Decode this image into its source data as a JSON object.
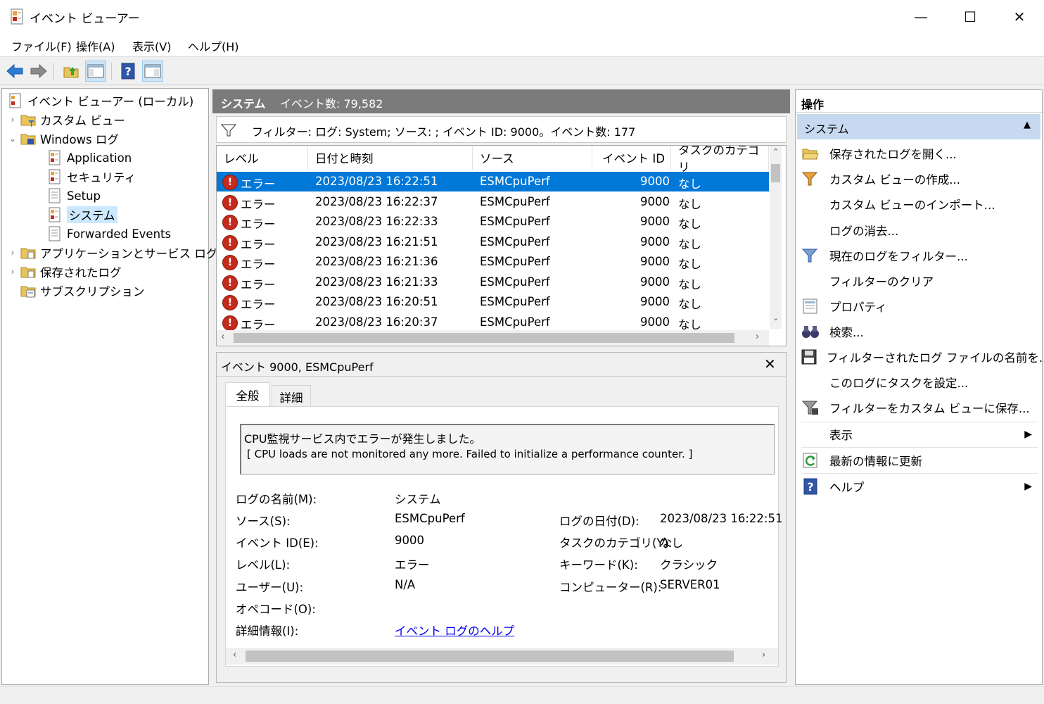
{
  "window": {
    "title": "イベント ビューアー",
    "minimize": "—",
    "maximize": "☐",
    "close": "✕"
  },
  "menu": [
    "ファイル(F)",
    "操作(A)",
    "表示(V)",
    "ヘルプ(H)"
  ],
  "tree": {
    "root": "イベント ビューアー (ローカル)",
    "custom_views": "カスタム ビュー",
    "windows_logs": "Windows ログ",
    "application": "Application",
    "security": "セキュリティ",
    "setup": "Setup",
    "system": "システム",
    "forwarded": "Forwarded Events",
    "app_service_logs": "アプリケーションとサービス ログ",
    "saved_logs": "保存されたログ",
    "subscriptions": "サブスクリプション"
  },
  "center": {
    "log_name": "システム",
    "event_count": "イベント数: 79,582",
    "filter_text": "フィルター: ログ: System; ソース: ; イベント ID: 9000。イベント数: 177"
  },
  "grid": {
    "columns": [
      "レベル",
      "日付と時刻",
      "ソース",
      "イベント ID",
      "タスクのカテゴリ"
    ],
    "rows": [
      {
        "level": "エラー",
        "datetime": "2023/08/23 16:22:51",
        "source": "ESMCpuPerf",
        "id": "9000",
        "category": "なし"
      },
      {
        "level": "エラー",
        "datetime": "2023/08/23 16:22:37",
        "source": "ESMCpuPerf",
        "id": "9000",
        "category": "なし"
      },
      {
        "level": "エラー",
        "datetime": "2023/08/23 16:22:33",
        "source": "ESMCpuPerf",
        "id": "9000",
        "category": "なし"
      },
      {
        "level": "エラー",
        "datetime": "2023/08/23 16:21:51",
        "source": "ESMCpuPerf",
        "id": "9000",
        "category": "なし"
      },
      {
        "level": "エラー",
        "datetime": "2023/08/23 16:21:36",
        "source": "ESMCpuPerf",
        "id": "9000",
        "category": "なし"
      },
      {
        "level": "エラー",
        "datetime": "2023/08/23 16:21:33",
        "source": "ESMCpuPerf",
        "id": "9000",
        "category": "なし"
      },
      {
        "level": "エラー",
        "datetime": "2023/08/23 16:20:51",
        "source": "ESMCpuPerf",
        "id": "9000",
        "category": "なし"
      },
      {
        "level": "エラー",
        "datetime": "2023/08/23 16:20:37",
        "source": "ESMCpuPerf",
        "id": "9000",
        "category": "なし"
      }
    ]
  },
  "detail": {
    "title": "イベント 9000, ESMCpuPerf",
    "tab_general": "全般",
    "tab_details": "詳細",
    "message_line1": "CPU監視サービス内でエラーが発生しました。",
    "message_line2": "[ CPU loads are not monitored any more. Failed to initialize a performance counter. ]",
    "log_name_label": "ログの名前(M):",
    "log_name_value": "システム",
    "source_label": "ソース(S):",
    "source_value": "ESMCpuPerf",
    "logged_label": "ログの日付(D):",
    "logged_value": "2023/08/23 16:22:51",
    "event_id_label": "イベント ID(E):",
    "event_id_value": "9000",
    "task_label": "タスクのカテゴリ(Y):",
    "task_value": "なし",
    "level_label": "レベル(L):",
    "level_value": "エラー",
    "keywords_label": "キーワード(K):",
    "keywords_value": "クラシック",
    "user_label": "ユーザー(U):",
    "user_value": "N/A",
    "computer_label": "コンピューター(R):",
    "computer_value": "SERVER01",
    "opcode_label": "オペコード(O):",
    "more_info_label": "詳細情報(I):",
    "more_info_link": "イベント ログのヘルプ"
  },
  "actions": {
    "header": "操作",
    "section": "システム",
    "items": [
      "保存されたログを開く...",
      "カスタム ビューの作成...",
      "カスタム ビューのインポート...",
      "ログの消去...",
      "現在のログをフィルター...",
      "フィルターのクリア",
      "プロパティ",
      "検索...",
      "フィルターされたログ ファイルの名前を...",
      "このログにタスクを設定...",
      "フィルターをカスタム ビューに保存...",
      "表示",
      "最新の情報に更新",
      "ヘルプ"
    ]
  },
  "colors": {
    "selection": "#0078d7",
    "tree_selection": "#cce8ff",
    "section_header": "#c6d9f0",
    "error": "#c42b1c",
    "header_gray": "#7b7b7b"
  }
}
